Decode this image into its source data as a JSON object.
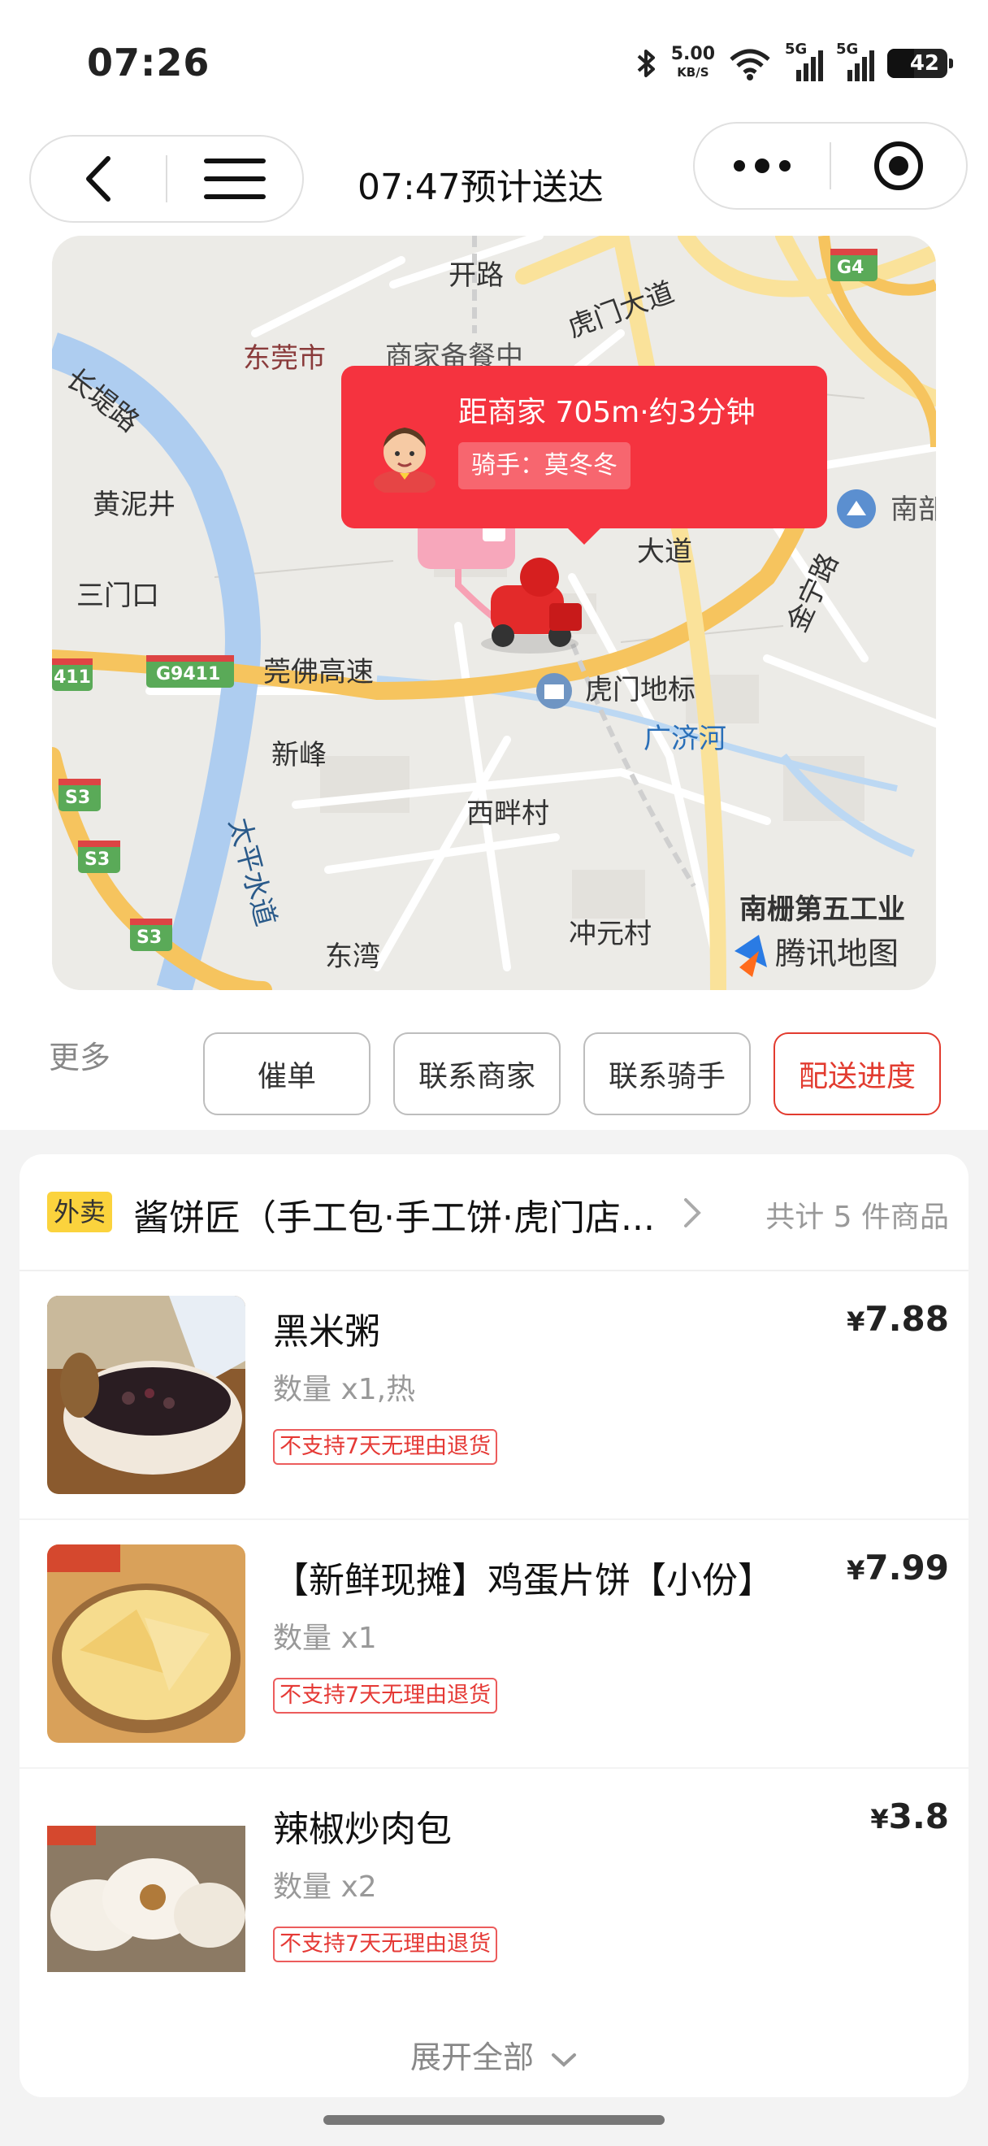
{
  "status_bar": {
    "time": "07:26",
    "net_speed_value": "5.00",
    "net_speed_unit": "KB/S",
    "signal1": "5G",
    "signal2": "5G",
    "battery": "42",
    "battery_level": 0.42
  },
  "nav": {
    "title": "07:47预计送达",
    "back_icon": "chevron-left-icon",
    "menu_icon": "hamburger-menu-icon",
    "more_icon": "more-dots-icon",
    "close_icon": "target-circle-icon"
  },
  "map": {
    "labels": {
      "changti": "长堤路",
      "dongguan": "东莞市",
      "shangjia_cut": "商家备餐中",
      "humen_dadao": "虎门大道",
      "huangnijing": "黄泥井",
      "sanmenkou": "三门口",
      "g9411": "G9411",
      "g9411_left": "411",
      "guanfo": "莞佛高速",
      "xinfeng": "新峰",
      "humen_landmark": "虎门地标",
      "guangji": "广济河",
      "xipan": "西畔村",
      "taiping": "太平水道",
      "s3_a": "S3",
      "s3_b": "S3",
      "s3_c": "S3",
      "dongwan": "东湾",
      "chongyuan": "冲元村",
      "nanshan": "南栅第五工业",
      "tencent": "腾讯地图",
      "g4": "G4",
      "nan": "南部",
      "jinning": "金宁路",
      "dadao_v": "大道",
      "kai_lu": "开路"
    },
    "popup": {
      "distance": "距商家  705m·约3分钟",
      "rider": "骑手：莫冬冬"
    }
  },
  "actions": {
    "more": "更多",
    "buttons": [
      "催单",
      "联系商家",
      "联系骑手",
      "配送进度"
    ]
  },
  "order": {
    "tag": "外卖",
    "store_name": "酱饼匠（手工包·手工饼·虎门店...",
    "item_count": "共计 5 件商品",
    "items": [
      {
        "name": "黑米粥",
        "qty": "数量 x1,热",
        "tag": "不支持7天无理由退货",
        "price_symbol": "¥",
        "price": "7.88"
      },
      {
        "name": "【新鲜现摊】鸡蛋片饼【小份】",
        "qty": "数量 x1",
        "tag": "不支持7天无理由退货",
        "price_symbol": "¥",
        "price": "7.99"
      },
      {
        "name": "辣椒炒肉包",
        "qty": "数量 x2",
        "tag": "不支持7天无理由退货",
        "price_symbol": "¥",
        "price": "3.8"
      }
    ],
    "expand": "展开全部"
  }
}
